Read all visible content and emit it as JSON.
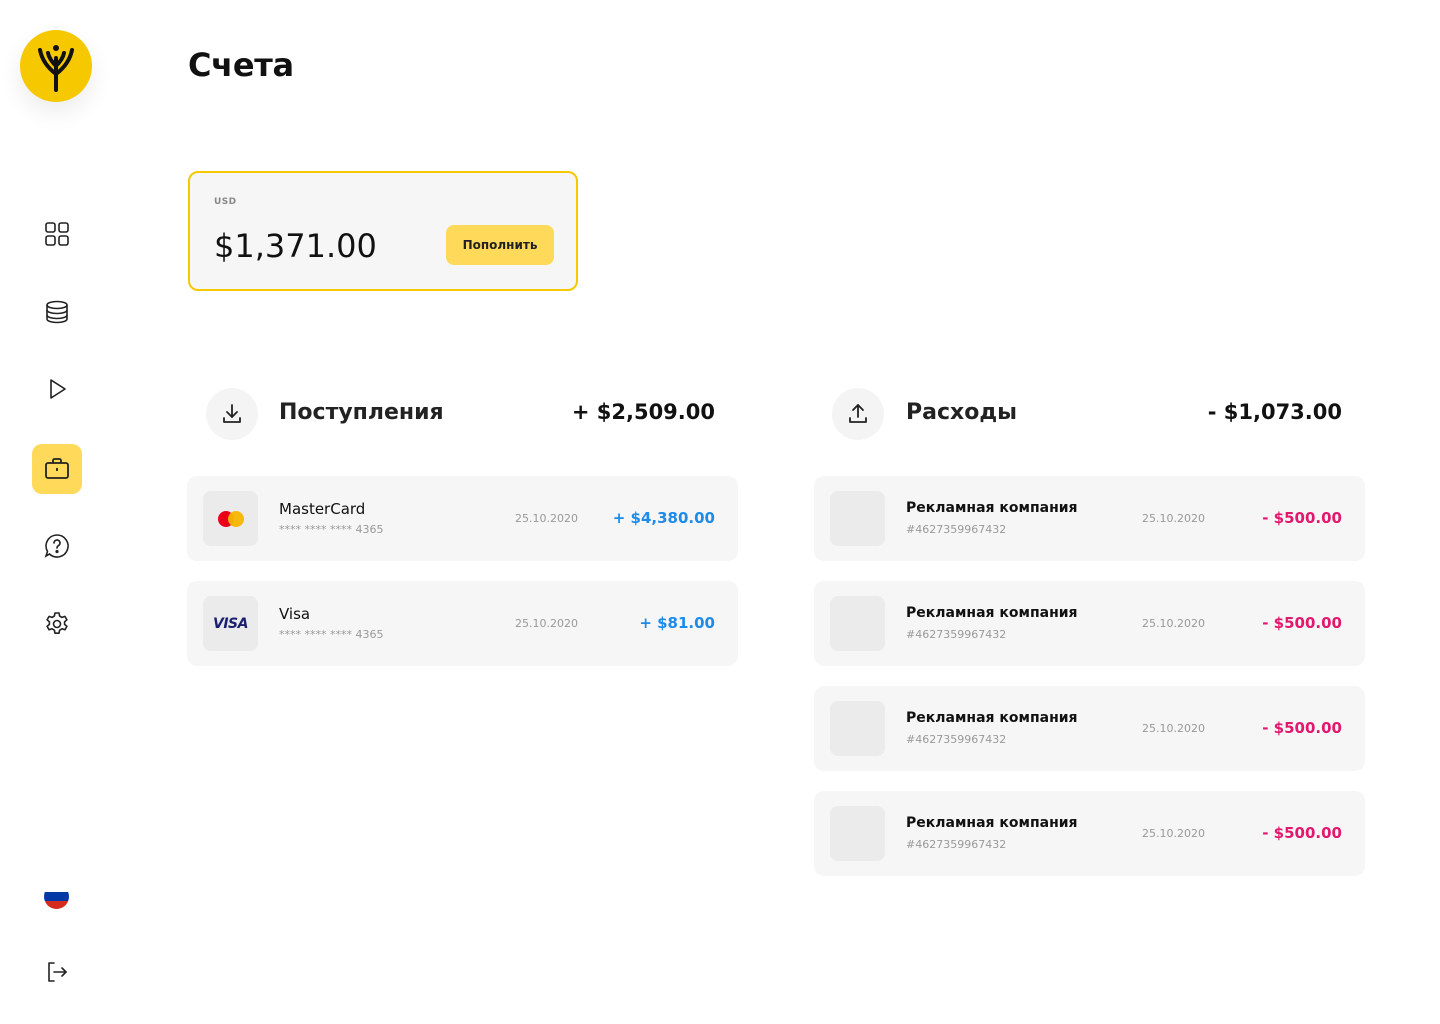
{
  "app": {
    "title": "Счета"
  },
  "sidebar": {
    "logo": "tree-logo-icon",
    "items": [
      {
        "id": "dashboard",
        "icon": "grid-icon",
        "active": false
      },
      {
        "id": "finance",
        "icon": "database-icon",
        "active": false
      },
      {
        "id": "media",
        "icon": "play-icon",
        "active": false
      },
      {
        "id": "accounts",
        "icon": "briefcase-icon",
        "active": true
      },
      {
        "id": "support",
        "icon": "help-chat-icon",
        "active": false
      },
      {
        "id": "settings",
        "icon": "gear-icon",
        "active": false
      }
    ],
    "language": "ru-flag-icon",
    "logout": "logout-icon"
  },
  "balance": {
    "currency": "USD",
    "amount": "$1,371.00",
    "topup_label": "Пополнить"
  },
  "income": {
    "title": "Поступления",
    "total": "+ $2,509.00",
    "icon": "download-icon",
    "items": [
      {
        "name": "MasterCard",
        "number": "**** **** **** 4365",
        "date": "25.10.2020",
        "amount": "+ $4,380.00",
        "icon": "mastercard-icon"
      },
      {
        "name": "Visa",
        "number": "**** **** **** 4365",
        "date": "25.10.2020",
        "amount": "+ $81.00",
        "icon": "visa-icon",
        "logo_text": "VISA"
      }
    ]
  },
  "expenses": {
    "title": "Расходы",
    "total": "- $1,073.00",
    "icon": "upload-icon",
    "items": [
      {
        "name": "Рекламная компания",
        "number": "#4627359967432",
        "date": "25.10.2020",
        "amount": "- $500.00"
      },
      {
        "name": "Рекламная компания",
        "number": "#4627359967432",
        "date": "25.10.2020",
        "amount": "- $500.00"
      },
      {
        "name": "Рекламная компания",
        "number": "#4627359967432",
        "date": "25.10.2020",
        "amount": "- $500.00"
      },
      {
        "name": "Рекламная компания",
        "number": "#4627359967432",
        "date": "25.10.2020",
        "amount": "- $500.00"
      }
    ]
  },
  "colors": {
    "brand_yellow": "#F6C800",
    "button_yellow": "#FFD95A",
    "income_blue": "#1C8BEA",
    "expense_pink": "#E2186E"
  }
}
